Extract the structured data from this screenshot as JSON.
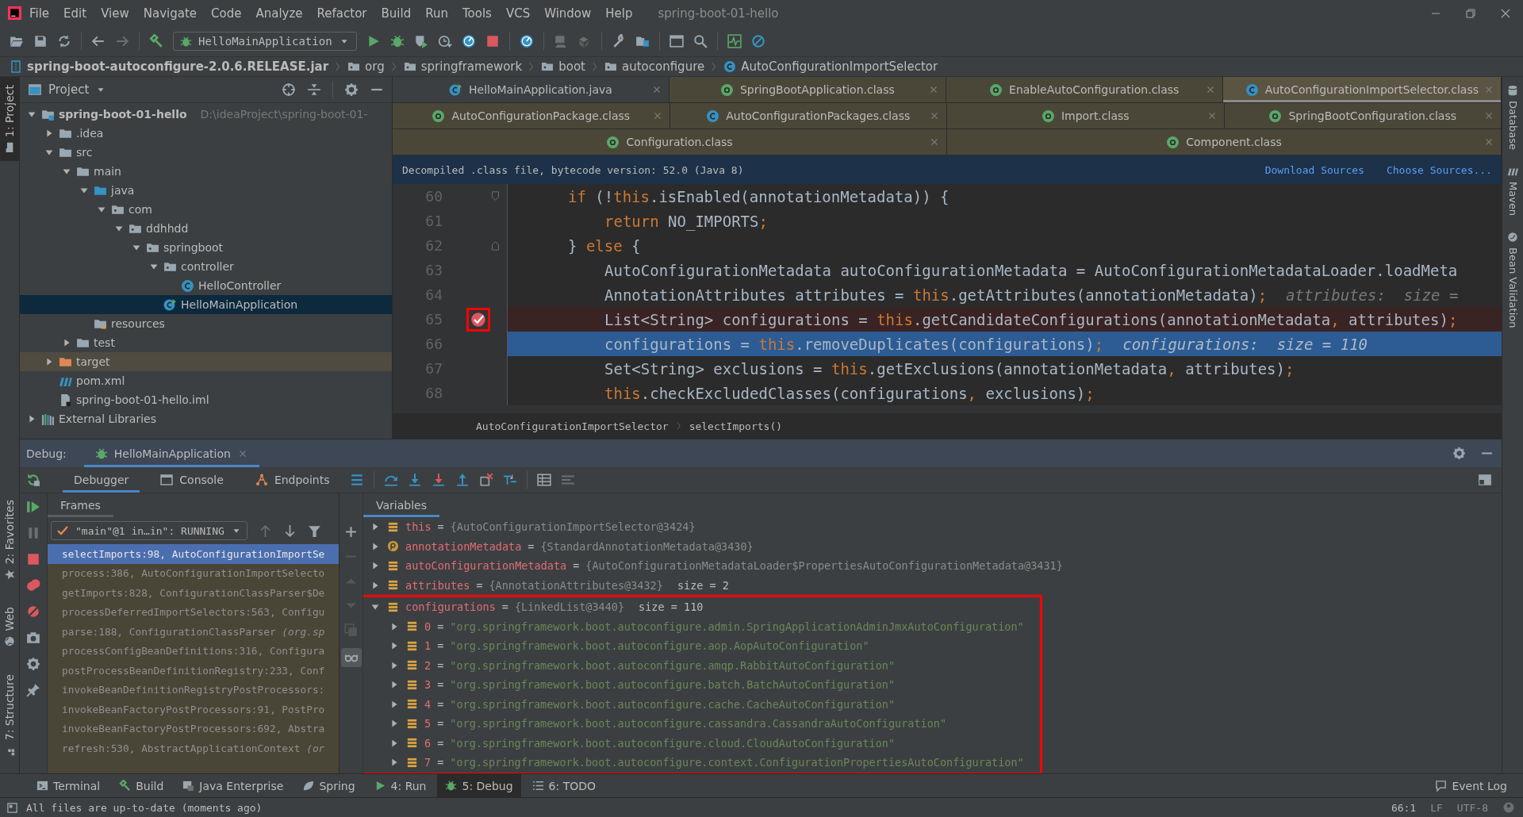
{
  "window": {
    "title": "spring-boot-01-hello"
  },
  "menu": [
    "File",
    "Edit",
    "View",
    "Navigate",
    "Code",
    "Analyze",
    "Refactor",
    "Build",
    "Run",
    "Tools",
    "VCS",
    "Window",
    "Help"
  ],
  "toolbar": {
    "run_config": "HelloMainApplication"
  },
  "nav_bar": [
    {
      "label": "spring-boot-autoconfigure-2.0.6.RELEASE.jar",
      "kind": "jar"
    },
    {
      "label": "org",
      "kind": "package"
    },
    {
      "label": "springframework",
      "kind": "package"
    },
    {
      "label": "boot",
      "kind": "package"
    },
    {
      "label": "autoconfigure",
      "kind": "package"
    },
    {
      "label": "AutoConfigurationImportSelector",
      "kind": "class"
    }
  ],
  "left_strip": {
    "top": [
      {
        "label": "1: Project",
        "kind": "project",
        "selected": true
      }
    ],
    "bottom": [
      {
        "label": "2: Favorites",
        "kind": "favorites",
        "selected": false
      },
      {
        "label": "Web",
        "kind": "web",
        "selected": false
      },
      {
        "label": "7: Structure",
        "kind": "structure",
        "selected": false
      }
    ]
  },
  "right_strip": [
    {
      "label": "Database",
      "kind": "database"
    },
    {
      "label": "Maven",
      "kind": "maven"
    },
    {
      "label": "Bean Validation",
      "kind": "bean"
    }
  ],
  "project": {
    "title": "Project",
    "tree": [
      {
        "label": "spring-boot-01-hello",
        "path": "D:\\ideaProject\\spring-boot-01-",
        "kind": "module",
        "expanded": true,
        "selected": false,
        "children": [
          {
            "label": ".idea",
            "kind": "folder",
            "expanded": false,
            "selected": false
          },
          {
            "label": "src",
            "kind": "folder",
            "expanded": true,
            "selected": false,
            "children": [
              {
                "label": "main",
                "kind": "folder",
                "expanded": true,
                "selected": false,
                "children": [
                  {
                    "label": "java",
                    "kind": "source",
                    "expanded": true,
                    "selected": false,
                    "children": [
                      {
                        "label": "com",
                        "kind": "package",
                        "expanded": true,
                        "selected": false,
                        "children": [
                          {
                            "label": "ddhhdd",
                            "kind": "package",
                            "expanded": true,
                            "selected": false,
                            "children": [
                              {
                                "label": "springboot",
                                "kind": "package",
                                "expanded": true,
                                "selected": false,
                                "children": [
                                  {
                                    "label": "controller",
                                    "kind": "package",
                                    "expanded": true,
                                    "selected": false,
                                    "children": [
                                      {
                                        "label": "HelloController",
                                        "kind": "class",
                                        "selected": false
                                      }
                                    ]
                                  },
                                  {
                                    "label": "HelloMainApplication",
                                    "kind": "main-class",
                                    "selected": true
                                  }
                                ]
                              }
                            ]
                          }
                        ]
                      }
                    ]
                  },
                  {
                    "label": "resources",
                    "kind": "resources",
                    "selected": false
                  }
                ]
              },
              {
                "label": "test",
                "kind": "folder",
                "expanded": false,
                "selected": false
              }
            ]
          },
          {
            "label": "target",
            "kind": "excluded",
            "expanded": false,
            "selected": false
          },
          {
            "label": "pom.xml",
            "kind": "maven",
            "selected": false
          },
          {
            "label": "spring-boot-01-hello.iml",
            "kind": "iml",
            "selected": false
          }
        ]
      },
      {
        "label": "External Libraries",
        "kind": "libraries",
        "expanded": false,
        "selected": false
      }
    ]
  },
  "editor": {
    "tab_rows": [
      [
        {
          "label": "HelloMainApplication.java",
          "kind": "main-class",
          "library": false,
          "selected": false
        },
        {
          "label": "SpringBootApplication.class",
          "kind": "annotation",
          "library": true,
          "selected": false
        },
        {
          "label": "EnableAutoConfiguration.class",
          "kind": "annotation",
          "library": true,
          "selected": false
        },
        {
          "label": "AutoConfigurationImportSelector.class",
          "kind": "class",
          "library": true,
          "selected": true
        }
      ],
      [
        {
          "label": "AutoConfigurationPackage.class",
          "kind": "annotation",
          "library": true,
          "selected": false
        },
        {
          "label": "AutoConfigurationPackages.class",
          "kind": "class",
          "library": true,
          "selected": false
        },
        {
          "label": "Import.class",
          "kind": "annotation",
          "library": true,
          "selected": false
        },
        {
          "label": "SpringBootConfiguration.class",
          "kind": "annotation",
          "library": true,
          "selected": false
        }
      ],
      [
        {
          "label": "Configuration.class",
          "kind": "annotation",
          "library": true,
          "selected": false
        },
        {
          "label": "Component.class",
          "kind": "annotation",
          "library": true,
          "selected": false
        }
      ]
    ],
    "banner": {
      "text": "Decompiled .class file, bytecode version: 52.0 (Java 8)",
      "links": [
        "Download Sources",
        "Choose Sources..."
      ]
    },
    "lines": [
      {
        "number": "60",
        "fold": true,
        "breakpoint": false,
        "current": false,
        "highlighted": false,
        "tokens": [
          {
            "text": "if",
            "kind": "keyword"
          },
          {
            "text": " (!",
            "kind": "plain"
          },
          {
            "text": "this",
            "kind": "keyword"
          },
          {
            "text": ".isEnabled(annotationMetadata)) {",
            "kind": "plain"
          }
        ],
        "children": [
          {
            "number": "61",
            "fold": false,
            "breakpoint": false,
            "current": false,
            "highlighted": false,
            "tokens": [
              {
                "text": "return",
                "kind": "keyword"
              },
              {
                "text": " NO_IMPORTS",
                "kind": "plain"
              },
              {
                "text": ";",
                "kind": "keyword"
              }
            ]
          }
        ]
      },
      {
        "number": "62",
        "fold": true,
        "breakpoint": false,
        "current": false,
        "highlighted": false,
        "tokens": [
          {
            "text": "} ",
            "kind": "plain"
          },
          {
            "text": "else",
            "kind": "keyword"
          },
          {
            "text": " {",
            "kind": "plain"
          }
        ],
        "children": [
          {
            "number": "63",
            "fold": false,
            "breakpoint": false,
            "current": false,
            "highlighted": false,
            "tokens": [
              {
                "text": "AutoConfigurationMetadata autoConfigurationMetadata = AutoConfigurationMetadataLoader.loadMeta",
                "kind": "plain"
              }
            ]
          },
          {
            "number": "64",
            "fold": false,
            "breakpoint": false,
            "current": false,
            "highlighted": false,
            "tokens": [
              {
                "text": "AnnotationAttributes attributes = ",
                "kind": "plain"
              },
              {
                "text": "this",
                "kind": "keyword"
              },
              {
                "text": ".getAttributes(annotationMetadata)",
                "kind": "plain"
              },
              {
                "text": ";",
                "kind": "keyword"
              }
            ],
            "hint": "attributes:  size ="
          },
          {
            "number": "65",
            "fold": false,
            "breakpoint": true,
            "current": false,
            "highlighted": true,
            "tokens": [
              {
                "text": "List<String> configurations = ",
                "kind": "plain"
              },
              {
                "text": "this",
                "kind": "keyword"
              },
              {
                "text": ".getCandidateConfigurations(annotationMetadata",
                "kind": "plain"
              },
              {
                "text": ",",
                "kind": "keyword"
              },
              {
                "text": " attributes)",
                "kind": "plain"
              },
              {
                "text": ";",
                "kind": "keyword"
              }
            ]
          },
          {
            "number": "66",
            "fold": false,
            "breakpoint": false,
            "current": true,
            "highlighted": false,
            "tokens": [
              {
                "text": "configurations = ",
                "kind": "plain"
              },
              {
                "text": "this",
                "kind": "keyword"
              },
              {
                "text": ".removeDuplicates(configurations)",
                "kind": "plain"
              },
              {
                "text": ";",
                "kind": "keyword"
              }
            ],
            "hint": "configurations:  size = 110"
          },
          {
            "number": "67",
            "fold": false,
            "breakpoint": false,
            "current": false,
            "highlighted": false,
            "tokens": [
              {
                "text": "Set<String> exclusions = ",
                "kind": "plain"
              },
              {
                "text": "this",
                "kind": "keyword"
              },
              {
                "text": ".getExclusions(annotationMetadata",
                "kind": "plain"
              },
              {
                "text": ",",
                "kind": "keyword"
              },
              {
                "text": " attributes)",
                "kind": "plain"
              },
              {
                "text": ";",
                "kind": "keyword"
              }
            ]
          },
          {
            "number": "68",
            "fold": false,
            "breakpoint": false,
            "current": false,
            "highlighted": false,
            "tokens": [
              {
                "text": "this",
                "kind": "keyword"
              },
              {
                "text": ".checkExcludedClasses(configurations",
                "kind": "plain"
              },
              {
                "text": ",",
                "kind": "keyword"
              },
              {
                "text": " exclusions)",
                "kind": "plain"
              },
              {
                "text": ";",
                "kind": "keyword"
              }
            ]
          }
        ]
      }
    ],
    "breadcrumb": [
      "AutoConfigurationImportSelector",
      "selectImports()"
    ]
  },
  "debug": {
    "label": "Debug:",
    "session": "HelloMainApplication",
    "tabs": [
      {
        "label": "Debugger",
        "kind": "debugger",
        "selected": true
      },
      {
        "label": "Console",
        "kind": "console",
        "selected": false
      },
      {
        "label": "Endpoints",
        "kind": "endpoints",
        "selected": false
      }
    ],
    "frames_title": "Frames",
    "thread": "\"main\"@1 in…in\": RUNNING",
    "frames": [
      {
        "text": "selectImports:98, AutoConfigurationImportSe",
        "selected": true
      },
      {
        "text": "process:386, AutoConfigurationImportSelecto",
        "selected": false
      },
      {
        "text": "getImports:828, ConfigurationClassParser$De",
        "selected": false
      },
      {
        "text": "processDeferredImportSelectors:563, Configu",
        "selected": false
      },
      {
        "text": "parse:188, ConfigurationClassParser *(org.sp*",
        "selected": false
      },
      {
        "text": "processConfigBeanDefinitions:316, Configura",
        "selected": false
      },
      {
        "text": "postProcessBeanDefinitionRegistry:233, Conf",
        "selected": false
      },
      {
        "text": "invokeBeanDefinitionRegistryPostProcessors:",
        "selected": false
      },
      {
        "text": "invokeBeanFactoryPostProcessors:91, PostPro",
        "selected": false
      },
      {
        "text": "invokeBeanFactoryPostProcessors:692, Abstra",
        "selected": false
      },
      {
        "text": "refresh:530, AbstractApplicationContext *(or*",
        "selected": false
      }
    ],
    "variables_title": "Variables",
    "variables": [
      {
        "name": "this",
        "sep": "=",
        "value": "{AutoConfigurationImportSelector@3424}",
        "kind": "field",
        "expanded": false,
        "highlighted": false
      },
      {
        "name": "annotationMetadata",
        "sep": "=",
        "value": "{StandardAnnotationMetadata@3430}",
        "kind": "param",
        "expanded": false,
        "highlighted": false
      },
      {
        "name": "autoConfigurationMetadata",
        "sep": "=",
        "value": "{AutoConfigurationMetadataLoader$PropertiesAutoConfigurationMetadata@3431}",
        "kind": "field",
        "expanded": false,
        "highlighted": false
      },
      {
        "name": "attributes",
        "sep": "=",
        "value": "{AnnotationAttributes@3432}",
        "size": "size = 2",
        "kind": "field",
        "expanded": false,
        "highlighted": false
      },
      {
        "name": "configurations",
        "sep": "=",
        "value": "{LinkedList@3440}",
        "size": "size = 110",
        "kind": "field",
        "expanded": true,
        "highlighted": true,
        "children": [
          {
            "name": "0",
            "sep": "=",
            "value": "\"org.springframework.boot.autoconfigure.admin.SpringApplicationAdminJmxAutoConfiguration\"",
            "expanded": false
          },
          {
            "name": "1",
            "sep": "=",
            "value": "\"org.springframework.boot.autoconfigure.aop.AopAutoConfiguration\"",
            "expanded": false
          },
          {
            "name": "2",
            "sep": "=",
            "value": "\"org.springframework.boot.autoconfigure.amqp.RabbitAutoConfiguration\"",
            "expanded": false
          },
          {
            "name": "3",
            "sep": "=",
            "value": "\"org.springframework.boot.autoconfigure.batch.BatchAutoConfiguration\"",
            "expanded": false
          },
          {
            "name": "4",
            "sep": "=",
            "value": "\"org.springframework.boot.autoconfigure.cache.CacheAutoConfiguration\"",
            "expanded": false
          },
          {
            "name": "5",
            "sep": "=",
            "value": "\"org.springframework.boot.autoconfigure.cassandra.CassandraAutoConfiguration\"",
            "expanded": false
          },
          {
            "name": "6",
            "sep": "=",
            "value": "\"org.springframework.boot.autoconfigure.cloud.CloudAutoConfiguration\"",
            "expanded": false
          },
          {
            "name": "7",
            "sep": "=",
            "value": "\"org.springframework.boot.autoconfigure.context.ConfigurationPropertiesAutoConfiguration\"",
            "expanded": false
          }
        ]
      }
    ]
  },
  "tool_windows": [
    {
      "label": "Terminal",
      "kind": "terminal",
      "selected": false
    },
    {
      "label": "Build",
      "kind": "build",
      "selected": false
    },
    {
      "label": "Java Enterprise",
      "kind": "enterprise",
      "selected": false
    },
    {
      "label": "Spring",
      "kind": "spring",
      "selected": false
    },
    {
      "label": "4: Run",
      "kind": "run",
      "selected": false
    },
    {
      "label": "5: Debug",
      "kind": "debug",
      "selected": true
    },
    {
      "label": "6: TODO",
      "kind": "todo",
      "selected": false
    }
  ],
  "event_log": "Event Log",
  "status_bar": {
    "message": "All files are up-to-date (moments ago)",
    "position": "66:1",
    "line_separator": "LF",
    "encoding": "UTF-8"
  }
}
